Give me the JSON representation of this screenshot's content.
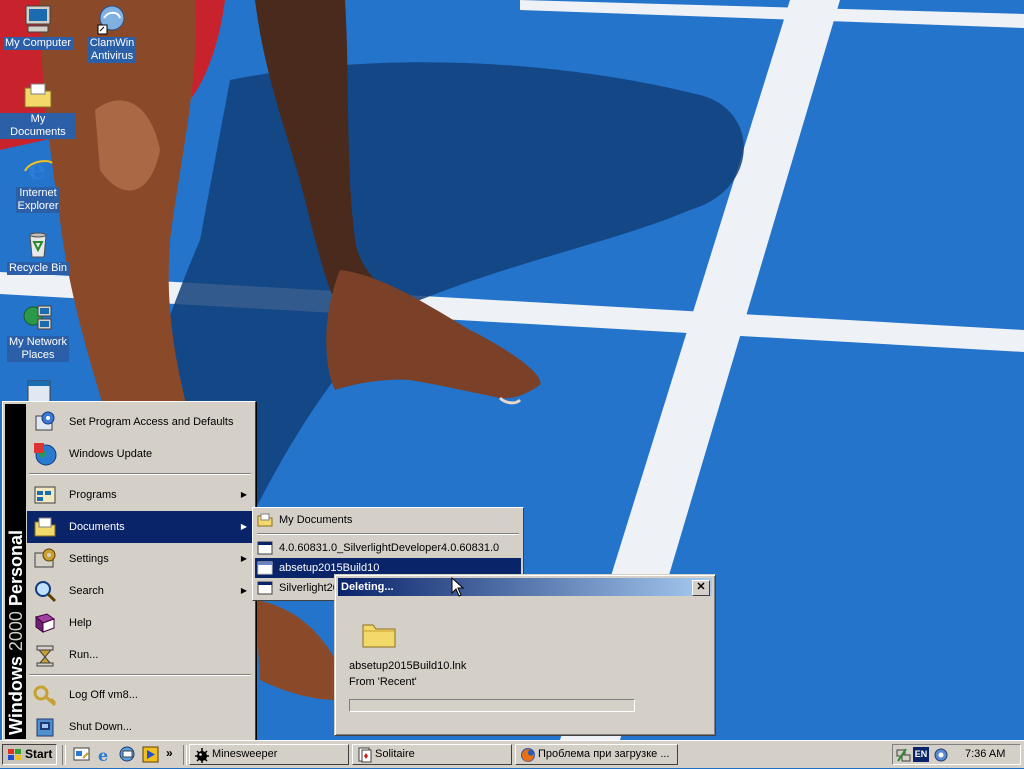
{
  "desktop": {
    "icons": [
      {
        "label_line1": "My Computer",
        "label_line2": ""
      },
      {
        "label_line1": "ClamWin",
        "label_line2": "Antivirus"
      },
      {
        "label_line1": "My Documents",
        "label_line2": ""
      },
      {
        "label_line1": "Internet",
        "label_line2": "Explorer"
      },
      {
        "label_line1": "Recycle Bin",
        "label_line2": ""
      },
      {
        "label_line1": "My Network",
        "label_line2": "Places"
      }
    ]
  },
  "start_menu": {
    "banner_bold": "Windows",
    "banner_thin": "2000",
    "banner_edition": "Personal",
    "items": [
      {
        "label": "Set Program Access and Defaults",
        "icon": "program-access-icon",
        "submenu": false
      },
      {
        "label": "Windows Update",
        "icon": "windows-update-icon",
        "submenu": false
      },
      {
        "label": "Programs",
        "icon": "programs-icon",
        "submenu": true
      },
      {
        "label": "Documents",
        "icon": "documents-folder-icon",
        "submenu": true,
        "active": true
      },
      {
        "label": "Settings",
        "icon": "settings-icon",
        "submenu": true
      },
      {
        "label": "Search",
        "icon": "search-icon",
        "submenu": true
      },
      {
        "label": "Help",
        "icon": "help-book-icon",
        "submenu": false
      },
      {
        "label": "Run...",
        "icon": "run-icon",
        "submenu": false
      },
      {
        "label": "Log Off vm8...",
        "icon": "log-off-icon",
        "submenu": false
      },
      {
        "label": "Shut Down...",
        "icon": "shut-down-icon",
        "submenu": false
      }
    ]
  },
  "documents_submenu": {
    "items": [
      {
        "label": "My Documents",
        "icon": "folder-icon"
      },
      {
        "label": "4.0.60831.0_SilverlightDeveloper4.0.60831.0",
        "icon": "shortcut-icon"
      },
      {
        "label": "absetup2015Build10",
        "icon": "shortcut-icon",
        "active": true
      },
      {
        "label": "Silverlight20",
        "icon": "shortcut-icon"
      }
    ]
  },
  "dialog": {
    "title": "Deleting...",
    "close_label": "✕",
    "file_name": "absetup2015Build10.lnk",
    "from_text": "From 'Recent'",
    "progress": 0
  },
  "taskbar": {
    "start_label": "Start",
    "chevron": "»",
    "tasks": [
      {
        "label": "Minesweeper",
        "icon": "minesweeper-icon"
      },
      {
        "label": "Solitaire",
        "icon": "solitaire-icon"
      },
      {
        "label": "Проблема при загрузке ...",
        "icon": "firefox-icon"
      }
    ],
    "tray": {
      "language": "EN",
      "clock": "7:36 AM"
    }
  },
  "colors": {
    "highlight": "#0a246a",
    "face": "#d4d0c8",
    "track_blue": "#1f6fc4"
  }
}
